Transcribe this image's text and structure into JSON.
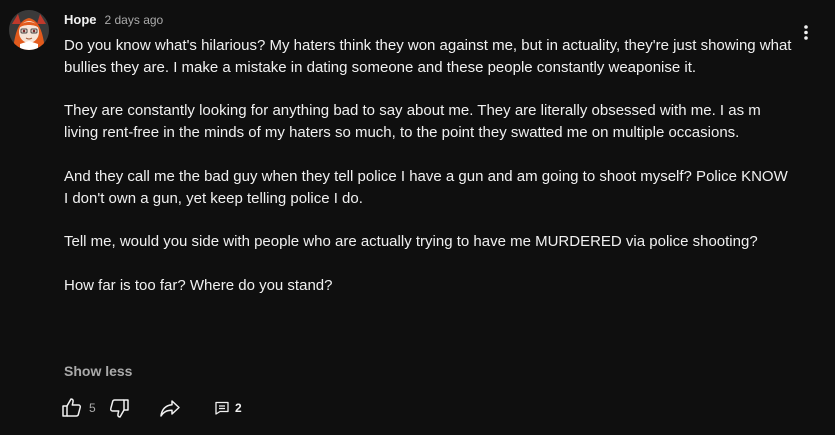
{
  "comment": {
    "author": "Hope",
    "timestamp": "2 days ago",
    "paragraphs": [
      "Do you know what's hilarious? My haters think they won against me, but in actuality, they're just showing what bullies they are. I make a mistake in dating someone and these people constantly weaponise it.",
      "They are constantly looking for anything bad to say about me. They are literally obsessed with me. I as m living rent-free in the minds of my haters so much, to the point they swatted me on multiple occasions.",
      "And they call me the bad guy when they tell police I have a gun and am going to shoot myself? Police KNOW I don't own a gun, yet keep telling police I do.",
      "Tell me, would you side with people who are actually trying to have me MURDERED via police shooting?",
      "How far is too far? Where do you stand?"
    ],
    "show_less_label": "Show less",
    "like_count": "5",
    "reply_count": "2"
  },
  "icons": {
    "menu": "more-vert-icon",
    "like": "thumb-up-icon",
    "dislike": "thumb-down-icon",
    "share": "share-icon",
    "replies": "comment-icon"
  },
  "colors": {
    "background": "#0f0f0f",
    "text": "#f1f1f1",
    "secondary_text": "#aaaaaa"
  }
}
